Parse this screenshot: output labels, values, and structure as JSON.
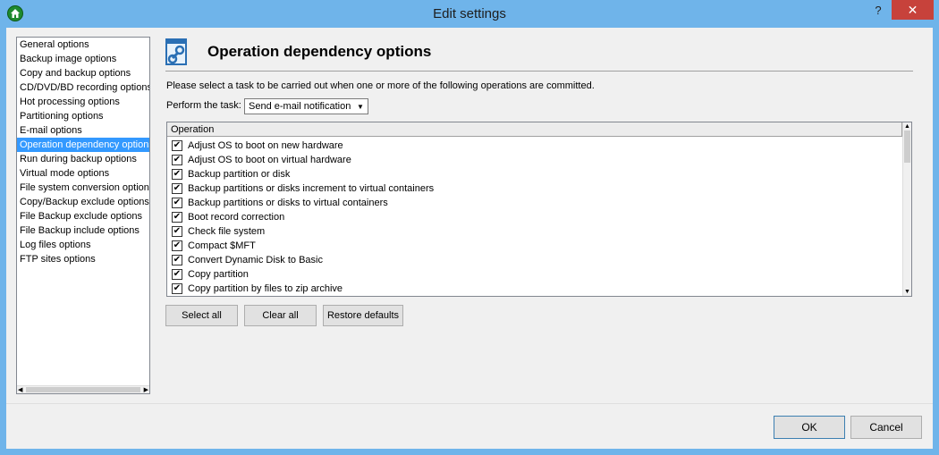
{
  "window": {
    "title": "Edit settings",
    "help_glyph": "?",
    "close_glyph": "✕"
  },
  "nav": {
    "items": [
      {
        "label": "General options"
      },
      {
        "label": "Backup image options"
      },
      {
        "label": "Copy and backup options"
      },
      {
        "label": "CD/DVD/BD recording options"
      },
      {
        "label": "Hot processing options"
      },
      {
        "label": "Partitioning options"
      },
      {
        "label": "E-mail options"
      },
      {
        "label": "Operation dependency options"
      },
      {
        "label": "Run during backup options"
      },
      {
        "label": "Virtual mode options"
      },
      {
        "label": "File system conversion options"
      },
      {
        "label": "Copy/Backup exclude options"
      },
      {
        "label": "File Backup exclude options"
      },
      {
        "label": "File Backup include options"
      },
      {
        "label": "Log files options"
      },
      {
        "label": "FTP sites options"
      }
    ],
    "selected_index": 7
  },
  "page": {
    "title": "Operation dependency options",
    "instruction": "Please select a task to be carried out when one or more of the following operations are committed.",
    "task_label": "Perform the task:",
    "task_value": "Send e-mail notification"
  },
  "grid": {
    "header": "Operation",
    "rows": [
      {
        "label": "Adjust OS to boot on new hardware",
        "checked": true
      },
      {
        "label": "Adjust OS to boot on virtual hardware",
        "checked": true
      },
      {
        "label": "Backup partition or disk",
        "checked": true
      },
      {
        "label": "Backup partitions or disks increment to virtual containers",
        "checked": true
      },
      {
        "label": "Backup partitions or disks to virtual containers",
        "checked": true
      },
      {
        "label": "Boot record correction",
        "checked": true
      },
      {
        "label": "Check file system",
        "checked": true
      },
      {
        "label": "Compact $MFT",
        "checked": true
      },
      {
        "label": "Convert Dynamic Disk to Basic",
        "checked": true
      },
      {
        "label": "Copy partition",
        "checked": true
      },
      {
        "label": "Copy partition by files to zip archive",
        "checked": true
      }
    ]
  },
  "buttons": {
    "select_all": "Select all",
    "clear_all": "Clear all",
    "restore_defaults": "Restore defaults",
    "ok": "OK",
    "cancel": "Cancel"
  },
  "colors": {
    "titlebar": "#6fb4ea",
    "selection": "#3399ff",
    "close": "#c7423b"
  }
}
